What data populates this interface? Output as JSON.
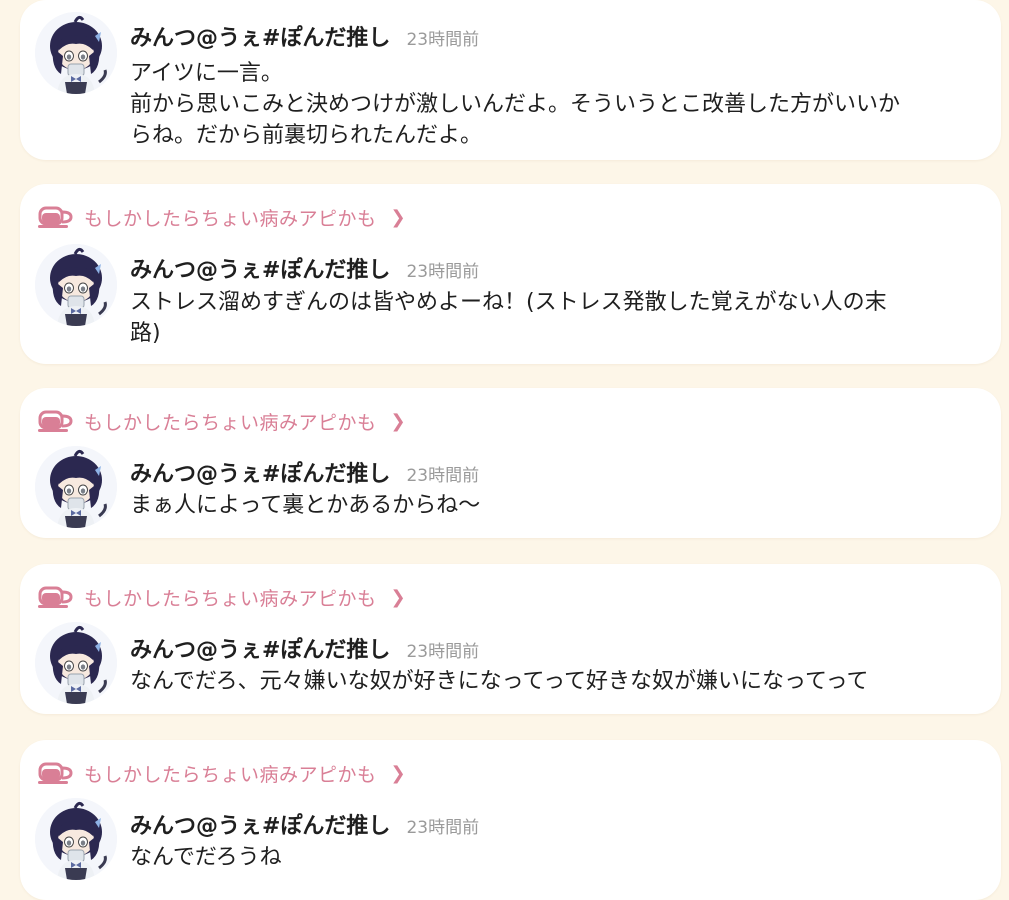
{
  "posts": [
    {
      "user": "みんつ@うぇ#ぽんだ推し",
      "time": "23時間前",
      "text": "アイツに一言。\n前から思いこみと決めつけが激しいんだよ。そういうとこ改善した方がいいか\nらね。だから前裏切られたんだよ。"
    },
    {
      "badge": "もしかしたらちょい病みアピかも",
      "user": "みんつ@うぇ#ぽんだ推し",
      "time": "23時間前",
      "text": "ストレス溜めすぎんのは皆やめよーね！(ストレス発散した覚えがない人の末\n路)"
    },
    {
      "badge": "もしかしたらちょい病みアピかも",
      "user": "みんつ@うぇ#ぽんだ推し",
      "time": "23時間前",
      "text": "まぁ人によって裏とかあるからね〜"
    },
    {
      "badge": "もしかしたらちょい病みアピかも",
      "user": "みんつ@うぇ#ぽんだ推し",
      "time": "23時間前",
      "text": "なんでだろ、元々嫌いな奴が好きになってって好きな奴が嫌いになってって"
    },
    {
      "badge": "もしかしたらちょい病みアピかも",
      "user": "みんつ@うぇ#ぽんだ推し",
      "time": "23時間前",
      "text": "なんでだろうね"
    }
  ],
  "icons": {
    "badge": "teacup-icon",
    "chevron": "chevron-right-icon",
    "avatar": "avatar"
  },
  "colors": {
    "background": "#fdf6e8",
    "card": "#ffffff",
    "badge": "#d97f96",
    "time": "#9a9a9a",
    "text": "#1f1f1f"
  }
}
